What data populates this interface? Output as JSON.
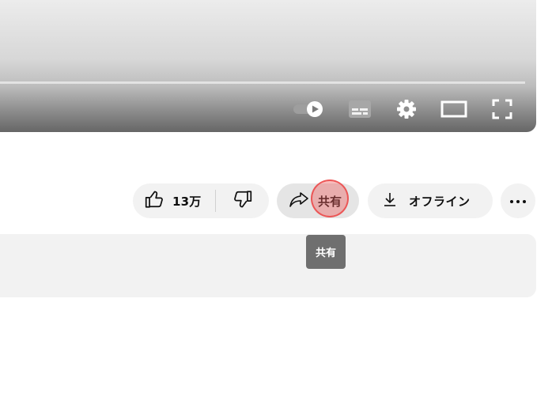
{
  "player": {
    "controls": [
      {
        "name": "autoplay-toggle",
        "icon": "autoplay-toggle-icon"
      },
      {
        "name": "subtitles-button",
        "icon": "subtitles-icon"
      },
      {
        "name": "settings-button",
        "icon": "gear-icon"
      },
      {
        "name": "theater-mode-button",
        "icon": "theater-mode-icon"
      },
      {
        "name": "fullscreen-button",
        "icon": "fullscreen-icon"
      }
    ]
  },
  "actions": {
    "like": {
      "label": "13万",
      "icon": "thumbs-up-icon"
    },
    "dislike": {
      "icon": "thumbs-down-icon"
    },
    "share": {
      "label": "共有",
      "icon": "share-arrow-icon"
    },
    "offline": {
      "label": "オフライン",
      "icon": "download-icon"
    },
    "more": {
      "icon": "more-horizontal-icon"
    }
  },
  "tooltip": {
    "text": "共有"
  },
  "colors": {
    "pill_bg": "#f2f2f2",
    "share_pill_bg": "#e5e5e5",
    "tooltip_bg": "#6f6f6f",
    "click_highlight": "#f05a5a",
    "text": "#0f0f0f"
  }
}
